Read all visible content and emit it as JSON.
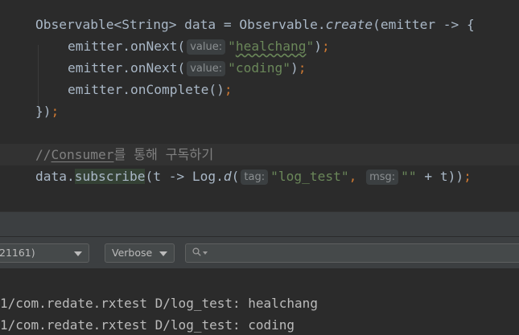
{
  "editor": {
    "line1": {
      "type_a": "Observable",
      "type_b": "<String>",
      "var": " data = Observable.",
      "method": "create",
      "rest": "(emitter -> {"
    },
    "line2": {
      "prefix": "emitter.onNext(",
      "hint": "value:",
      "q1": "\"",
      "word": "healchang",
      "q2": "\"",
      "close": ")",
      "semi": ";"
    },
    "line3": {
      "prefix": "emitter.onNext(",
      "hint": "value:",
      "str": "\"coding\"",
      "close": ")",
      "semi": ";"
    },
    "line4": {
      "text": "emitter.onComplete()",
      "semi": ";"
    },
    "line5": {
      "text": "})",
      "semi": ";"
    },
    "line6": {
      "slashes": "//",
      "word": "Consumer",
      "rest": "를 통해 구독하기"
    },
    "line7": {
      "obj": "data.",
      "method": "subscribe",
      "mid": "(t -> Log.",
      "log_method": "d",
      "paren": "(",
      "hint_tag": "tag:",
      "tag_str": "\"log_test\"",
      "comma": ",",
      "hint_msg": "msg:",
      "msg_str": "\"\"",
      "tail": " + t))",
      "semi": ";"
    }
  },
  "logcat": {
    "device_label": "21161)",
    "level_label": "Verbose",
    "search_value": "",
    "search_placeholder": "",
    "lines": [
      "1/com.redate.rxtest D/log_test: healchang",
      "1/com.redate.rxtest D/log_test: coding"
    ]
  }
}
